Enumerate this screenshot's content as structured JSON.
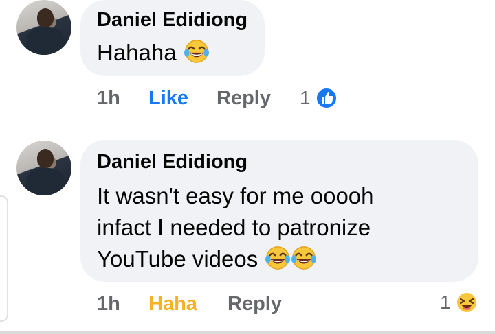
{
  "comments": [
    {
      "author": "Daniel Edidiong",
      "text_lines": [
        "Hahaha"
      ],
      "time": "1h",
      "reaction_label": "Like",
      "reply_label": "Reply",
      "reaction_count": "1",
      "reaction_icon": "like-icon"
    },
    {
      "author": "Daniel Edidiong",
      "text_lines": [
        "It wasn't easy for me ooooh",
        "infact I needed to patronize",
        "YouTube videos"
      ],
      "time": "1h",
      "reaction_label": "Haha",
      "reply_label": "Reply",
      "reaction_count": "1",
      "reaction_icon": "haha-icon"
    }
  ],
  "colors": {
    "bubble": "#f0f2f5",
    "like_blue": "#1877f2",
    "haha_yellow": "#f7b125",
    "meta_gray": "#65676b"
  }
}
